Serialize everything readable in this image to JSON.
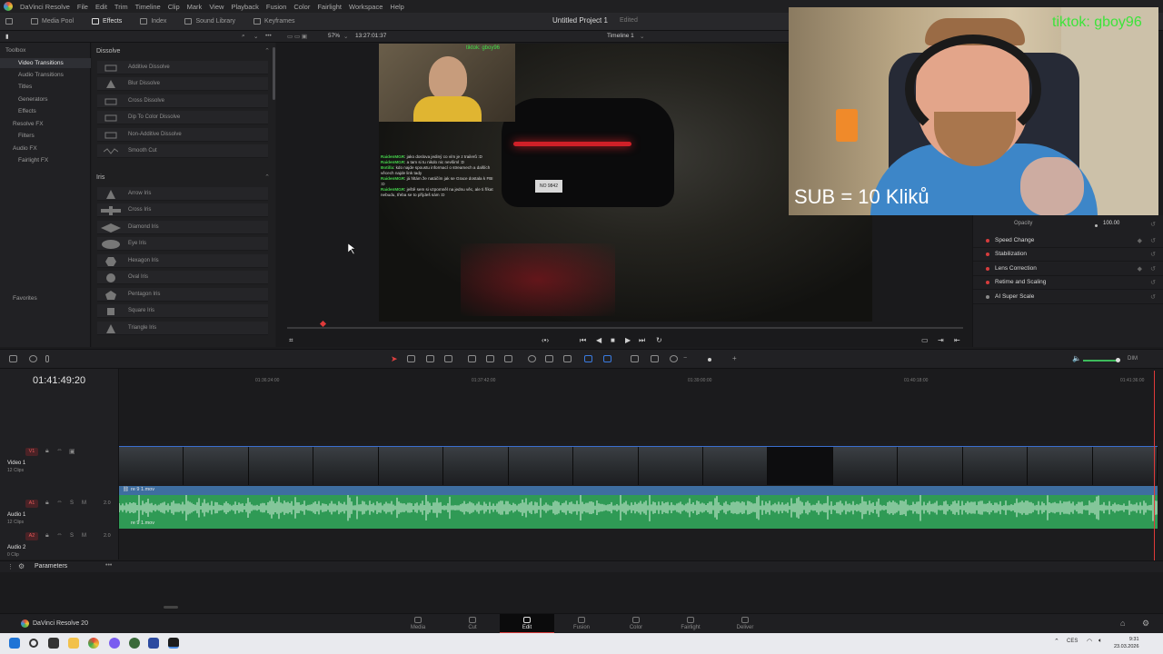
{
  "menubar": {
    "app": "DaVinci Resolve",
    "items": [
      "File",
      "Edit",
      "Trim",
      "Timeline",
      "Clip",
      "Mark",
      "View",
      "Playback",
      "Fusion",
      "Color",
      "Fairlight",
      "Workspace",
      "Help"
    ]
  },
  "toolbar": {
    "buttons": [
      "Media Pool",
      "Effects",
      "Index",
      "Sound Library",
      "Keyframes"
    ],
    "project_title": "Untitled Project 1",
    "project_status": "Edited"
  },
  "viewer": {
    "zoom": "57%",
    "timecode": "13:27:01:37",
    "timeline_name": "Timeline 1"
  },
  "sidebar": {
    "items": [
      "Toolbox",
      "Video Transitions",
      "Audio Transitions",
      "Titles",
      "Generators",
      "Effects",
      "Resolve FX",
      "Filters",
      "Audio FX",
      "Fairlight FX"
    ],
    "favorites": "Favorites"
  },
  "effects": {
    "sections": [
      "Dissolve",
      "Iris"
    ],
    "dissolve": [
      "Additive Dissolve",
      "Blur Dissolve",
      "Cross Dissolve",
      "Dip To Color Dissolve",
      "Non-Additive Dissolve",
      "Smooth Cut"
    ],
    "iris": [
      "Arrow Iris",
      "Cross Iris",
      "Diamond Iris",
      "Eye Iris",
      "Hexagon Iris",
      "Oval Iris",
      "Pentagon Iris",
      "Square Iris",
      "Triangle Iris"
    ]
  },
  "stream": {
    "tiktok_handle": "tiktok: gboy96",
    "sub_text": "SUB = 10 Kliků",
    "inner_tag": "tiktok: gboy96",
    "plate": "NO 9842",
    "chat": [
      {
        "user": "RaidenMGR",
        "text": "jako doslova jediný co vím je z trailerů :D"
      },
      {
        "user": "RaidenMGR",
        "text": "a tam si tu nikdo nic nevšiml :D"
      },
      {
        "user": "Botilla",
        "text": "kdo najde spoustu informací o streamech a dalších věcech najde link tady"
      },
      {
        "user": "RaidenMGR",
        "text": "já hltám že natáčím jak se Grace dostala k FBI :D"
      },
      {
        "user": "RaidenMGR",
        "text": "ještě sem si vzpomněl na jednu věc, ale ti říkat nebudu, třeba se to příjdeš sám :D"
      }
    ]
  },
  "inspector": {
    "opacity_label": "Opacity",
    "opacity_value": "100.00",
    "rows": [
      "Speed Change",
      "Stabilization",
      "Lens Correction",
      "Retime and Scaling",
      "AI Super Scale"
    ]
  },
  "timeline": {
    "timecode": "01:41:49:20",
    "ruler": [
      "01:36:24:00",
      "01:37:42:00",
      "01:39:00:00",
      "01:40:18:00",
      "01:41:36:00"
    ],
    "tracks": [
      {
        "tag": "V1",
        "name": "Video 1",
        "clips": "12 Clips"
      },
      {
        "tag": "A1",
        "name": "Audio 1",
        "clips": "12 Clips",
        "level": "2.0"
      },
      {
        "tag": "A2",
        "name": "Audio 2",
        "clips": "0 Clip",
        "level": "2.0"
      }
    ],
    "clip_name": "re 9 1.mov",
    "audio_clip_name": "re 9 1.mov",
    "params": "Parameters",
    "dim": "DIM"
  },
  "pages": {
    "app_name": "DaVinci Resolve 20",
    "tabs": [
      "Media",
      "Cut",
      "Edit",
      "Fusion",
      "Color",
      "Fairlight",
      "Deliver"
    ],
    "active": "Edit"
  },
  "taskbar": {
    "time": "9:31",
    "date": "23.03.2026",
    "lang": "CES"
  },
  "colors": {
    "accent_red": "#d63c3c",
    "audio_green": "#2f9a55",
    "clip_blue": "#3e6ea0"
  }
}
